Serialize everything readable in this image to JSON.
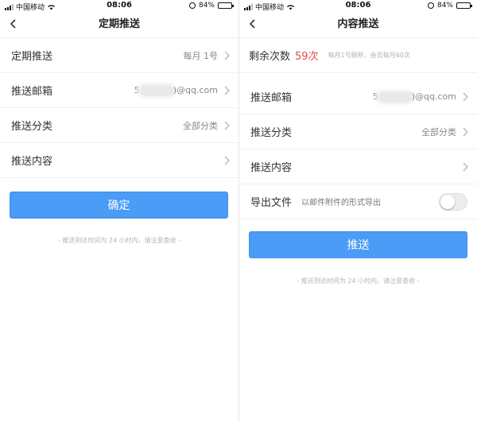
{
  "left": {
    "status": {
      "carrier": "中国移动",
      "time": "08:06",
      "battery": "84%"
    },
    "title": "定期推送",
    "rows": [
      {
        "label": "定期推送",
        "value": "每月 1号"
      },
      {
        "label": "推送邮箱",
        "value_prefix": "5",
        "value_suffix": ")@qq.com"
      },
      {
        "label": "推送分类",
        "value": "全部分类"
      },
      {
        "label": "推送内容",
        "value": ""
      }
    ],
    "button": "确定",
    "note": "- 推送到达时间为 24 小时内，请注意查收 -"
  },
  "right": {
    "status": {
      "carrier": "中国移动",
      "time": "08:06",
      "battery": "84%"
    },
    "title": "内容推送",
    "quota": {
      "label": "剩余次数",
      "count": "59次",
      "note": "每月1号刷新，会员每月60次"
    },
    "rows": [
      {
        "label": "推送邮箱",
        "value_prefix": "5",
        "value_suffix": ")@qq.com"
      },
      {
        "label": "推送分类",
        "value": "全部分类"
      },
      {
        "label": "推送内容",
        "value": ""
      }
    ],
    "export": {
      "label": "导出文件",
      "hint": "以邮件附件的形式导出",
      "enabled": false
    },
    "button": "推送",
    "note": "- 推送到达时间为 24 小时内，请注意查收 -"
  },
  "colors": {
    "accent": "#4a9cf6",
    "remaining": "#e14a4a"
  },
  "icons": [
    "back-chevron-icon",
    "chevron-right-icon",
    "signal-icon",
    "wifi-icon",
    "alarm-icon",
    "battery-icon"
  ]
}
